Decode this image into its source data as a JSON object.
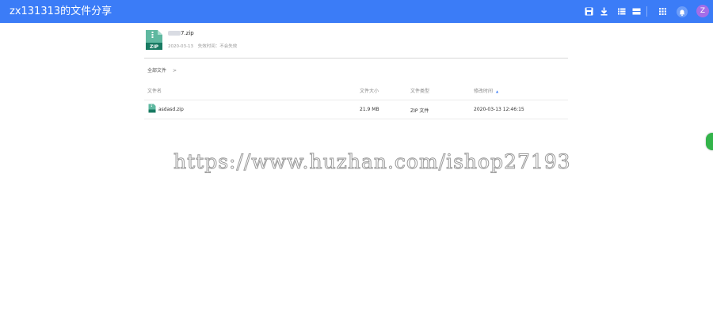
{
  "header": {
    "title": "zx131313的文件分享",
    "avatar_letter": "Z",
    "bar_color": "#3b7cf7",
    "icons": [
      "save-icon",
      "download-icon",
      "list-view-icon",
      "card-view-icon",
      "apps-grid-icon",
      "bell-icon"
    ]
  },
  "file": {
    "name_visible": "7.zip",
    "date": "2020-03-13",
    "expire": "失效时间：不会失效",
    "type_badge": "ZIP"
  },
  "breadcrumb": {
    "root": "全部文件",
    "separator": ">"
  },
  "table": {
    "columns": {
      "name": "文件名",
      "size": "文件大小",
      "type": "文件类型",
      "modified": "修改时间",
      "sort_arrow": "▲"
    },
    "rows": [
      {
        "name": "asdasd.zip",
        "size": "21.9 MB",
        "type": "ZIP 文件",
        "modified": "2020-03-13 12:46:15"
      }
    ]
  },
  "watermark": "https://www.huzhan.com/ishop27193"
}
